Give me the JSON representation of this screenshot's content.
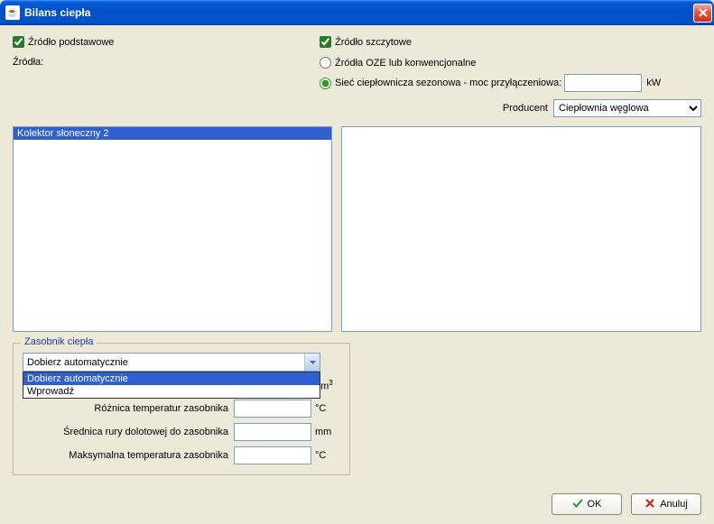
{
  "window": {
    "title": "Bilans ciepła"
  },
  "top": {
    "chk_primary_label": "Źródło podstawowe",
    "chk_peak_label": "Źródło szczytowe",
    "sources_label": "Źródła:",
    "radio_oze_label": "Źródła OZE lub konwencjonalne",
    "radio_siec_label": "Sieć ciepłownicza sezonowa - moc przyłączeniowa:",
    "siec_value": "",
    "siec_unit": "kW",
    "producer_label": "Producent",
    "producer_value": "Ciepłownia węglowa"
  },
  "lists": {
    "left_items": [
      "Kolektor słoneczny 2"
    ],
    "right_items": []
  },
  "tank": {
    "legend": "Zasobnik ciepła",
    "select_value": "Dobierz automatycznie",
    "options": [
      "Dobierz automatycznie",
      "Wprowadź"
    ],
    "row_volume_label": "",
    "row_volume_unit": "dm³",
    "row_diff_label": "Różnica temperatur zasobnika",
    "row_diff_unit": "°C",
    "row_diam_label": "Średnica rury dolotowej do zasobnika",
    "row_diam_unit": "mm",
    "row_max_label": "Maksymalna temperatura zasobnika",
    "row_max_unit": "°C"
  },
  "footer": {
    "ok_label": "OK",
    "cancel_label": "Anuluj"
  }
}
